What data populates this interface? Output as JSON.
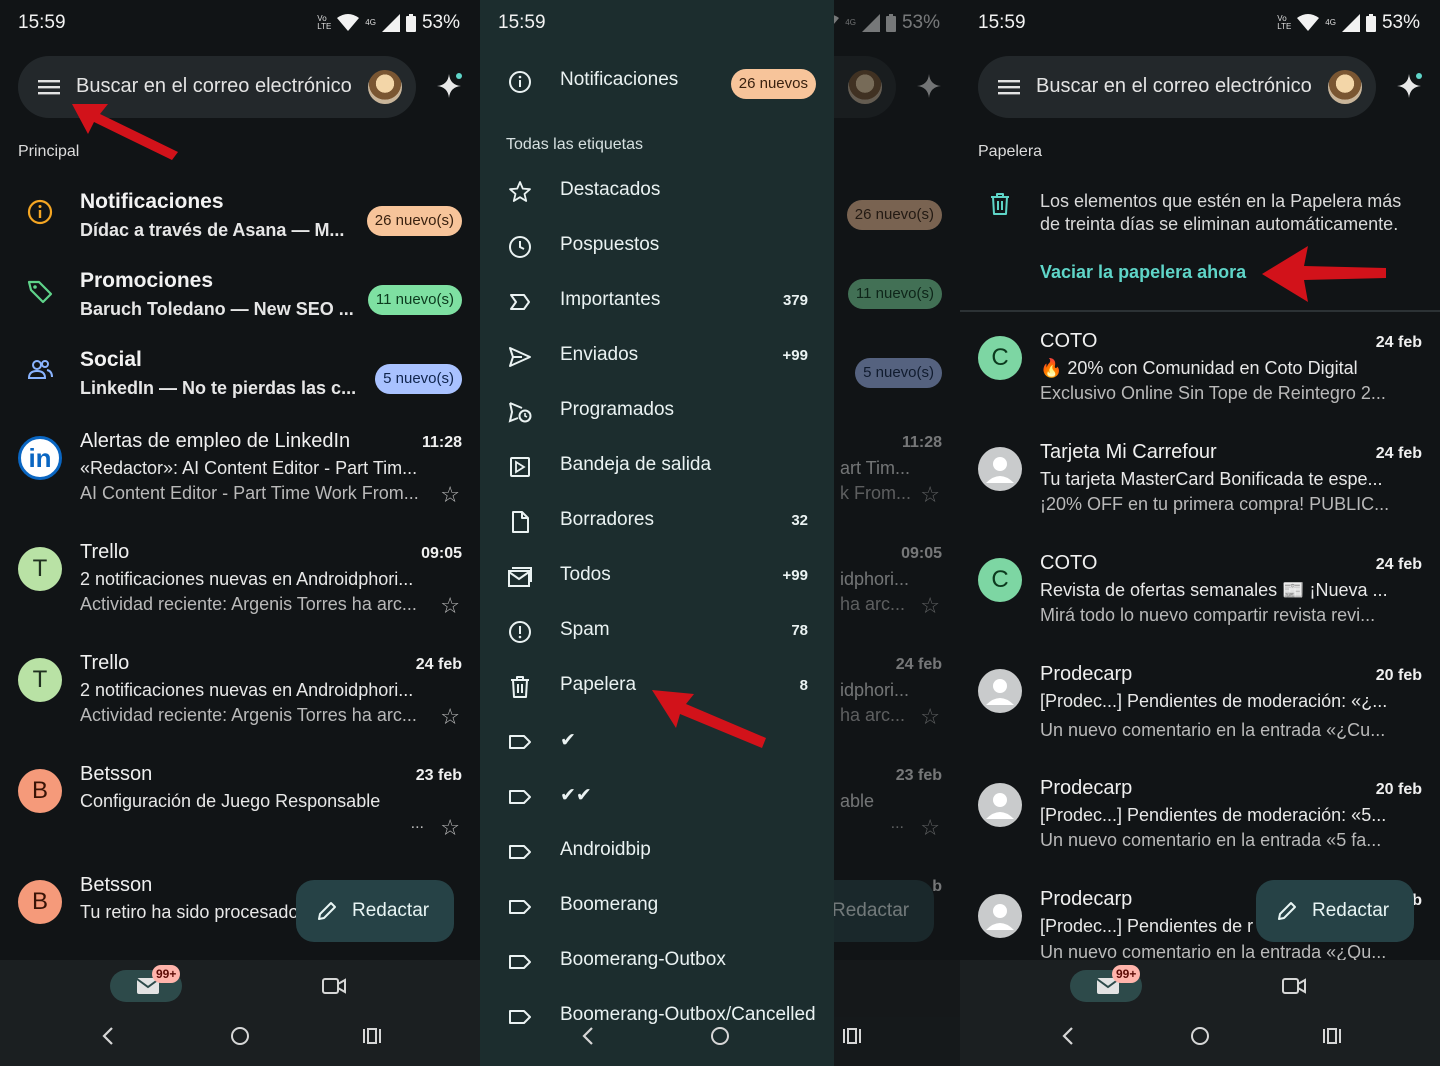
{
  "status": {
    "time": "15:59",
    "volte": "Vo LTE",
    "network": "4G",
    "battery": "53%"
  },
  "search": {
    "placeholder": "Buscar en el correo electrónico"
  },
  "compose": {
    "label": "Redactar"
  },
  "nav": {
    "mail_count": "99+"
  },
  "colors": {
    "accent": "#5fd5c8",
    "arrow": "#d2121a",
    "background": "#111416",
    "drawer": "#1c2d2e"
  },
  "panel1": {
    "section": "Principal",
    "categories": [
      {
        "icon": "info-icon",
        "title": "Notificaciones",
        "subtitle": "Dídac a través de Asana — M...",
        "badge": "26 nuevo(s)"
      },
      {
        "icon": "tag-icon",
        "title": "Promociones",
        "subtitle": "Baruch Toledano — New SEO ...",
        "badge": "11 nuevo(s)"
      },
      {
        "icon": "people-icon",
        "title": "Social",
        "subtitle": "LinkedIn — No te pierdas las c...",
        "badge": "5 nuevo(s)"
      }
    ],
    "emails": [
      {
        "avatar": "in",
        "sender": "Alertas de empleo de LinkedIn",
        "date": "11:28",
        "subject": "«Redactor»: AI Content Editor - Part Tim...",
        "snippet": "AI Content Editor - Part Time Work From..."
      },
      {
        "avatar": "T",
        "sender": "Trello",
        "date": "09:05",
        "subject": "2 notificaciones nuevas en Androidphori...",
        "snippet": "Actividad reciente: Argenis Torres ha arc..."
      },
      {
        "avatar": "T",
        "sender": "Trello",
        "date": "24 feb",
        "subject": "2 notificaciones nuevas en Androidphori...",
        "snippet": "Actividad reciente: Argenis Torres ha arc..."
      },
      {
        "avatar": "B",
        "sender": "Betsson",
        "date": "23 feb",
        "subject": "Configuración de Juego Responsable",
        "snippet": "..."
      },
      {
        "avatar": "B",
        "sender": "Betsson",
        "date": "",
        "subject": "Tu retiro ha sido procesado",
        "snippet": ""
      }
    ]
  },
  "panel2": {
    "notifications": {
      "label": "Notificaciones",
      "badge": "26 nuevos"
    },
    "all_labels": "Todas las etiquetas",
    "items": [
      {
        "icon": "star-icon",
        "label": "Destacados",
        "count": ""
      },
      {
        "icon": "clock-icon",
        "label": "Pospuestos",
        "count": ""
      },
      {
        "icon": "important-icon",
        "label": "Importantes",
        "count": "379"
      },
      {
        "icon": "send-icon",
        "label": "Enviados",
        "count": "+99"
      },
      {
        "icon": "scheduled-send-icon",
        "label": "Programados",
        "count": ""
      },
      {
        "icon": "outbox-icon",
        "label": "Bandeja de salida",
        "count": ""
      },
      {
        "icon": "draft-icon",
        "label": "Borradores",
        "count": "32"
      },
      {
        "icon": "all-mail-icon",
        "label": "Todos",
        "count": "+99"
      },
      {
        "icon": "spam-icon",
        "label": "Spam",
        "count": "78"
      },
      {
        "icon": "trash-icon",
        "label": "Papelera",
        "count": "8"
      },
      {
        "icon": "label-icon",
        "label": "✔",
        "count": ""
      },
      {
        "icon": "label-icon",
        "label": "✔✔",
        "count": ""
      },
      {
        "icon": "label-icon",
        "label": "Androidbip",
        "count": ""
      },
      {
        "icon": "label-icon",
        "label": "Boomerang",
        "count": ""
      },
      {
        "icon": "label-icon",
        "label": "Boomerang-Outbox",
        "count": ""
      },
      {
        "icon": "label-icon",
        "label": "Boomerang-Outbox/Cancelled",
        "count": ""
      }
    ],
    "background_fragments": [
      "26 nuevo(s)",
      "11 nuevo(s)",
      "5 nuevo(s)",
      "11:28",
      "art Tim...",
      "k From...",
      "09:05",
      "idphori...",
      "ha arc...",
      "24 feb",
      "idphori...",
      "ha arc...",
      "23 feb",
      "able",
      "...",
      "b"
    ]
  },
  "panel3": {
    "section": "Papelera",
    "info": "Los elementos que estén en la Papelera más de treinta días se eliminan automáticamente.",
    "empty_action": "Vaciar la papelera ahora",
    "emails": [
      {
        "avatar": "C",
        "sender": "COTO",
        "date": "24 feb",
        "subject": "🔥 20% con Comunidad en Coto Digital",
        "snippet": "Exclusivo Online Sin Tope de Reintegro 2..."
      },
      {
        "avatar": "person",
        "sender": "Tarjeta Mi Carrefour",
        "date": "24 feb",
        "subject": "Tu tarjeta MasterCard Bonificada te espe...",
        "snippet": "¡20% OFF en tu primera compra! PUBLIC..."
      },
      {
        "avatar": "C",
        "sender": "COTO",
        "date": "24 feb",
        "subject": "Revista de ofertas semanales 📰 ¡Nueva ...",
        "snippet": "Mirá todo lo nuevo compartir revista revi..."
      },
      {
        "avatar": "person",
        "sender": "Prodecarp",
        "date": "20 feb",
        "subject": "[Prodec...] Pendientes de moderación: «¿...",
        "snippet": "Un nuevo comentario en la entrada «¿Cu..."
      },
      {
        "avatar": "person",
        "sender": "Prodecarp",
        "date": "20 feb",
        "subject": "[Prodec...] Pendientes de moderación: «5...",
        "snippet": "Un nuevo comentario en la entrada «5 fa..."
      },
      {
        "avatar": "person",
        "sender": "Prodecarp",
        "date": "",
        "subject": "[Prodec...] Pendientes de r",
        "snippet": "Un nuevo comentario en la entrada «¿Qu..."
      }
    ],
    "date_fragment": "b"
  }
}
